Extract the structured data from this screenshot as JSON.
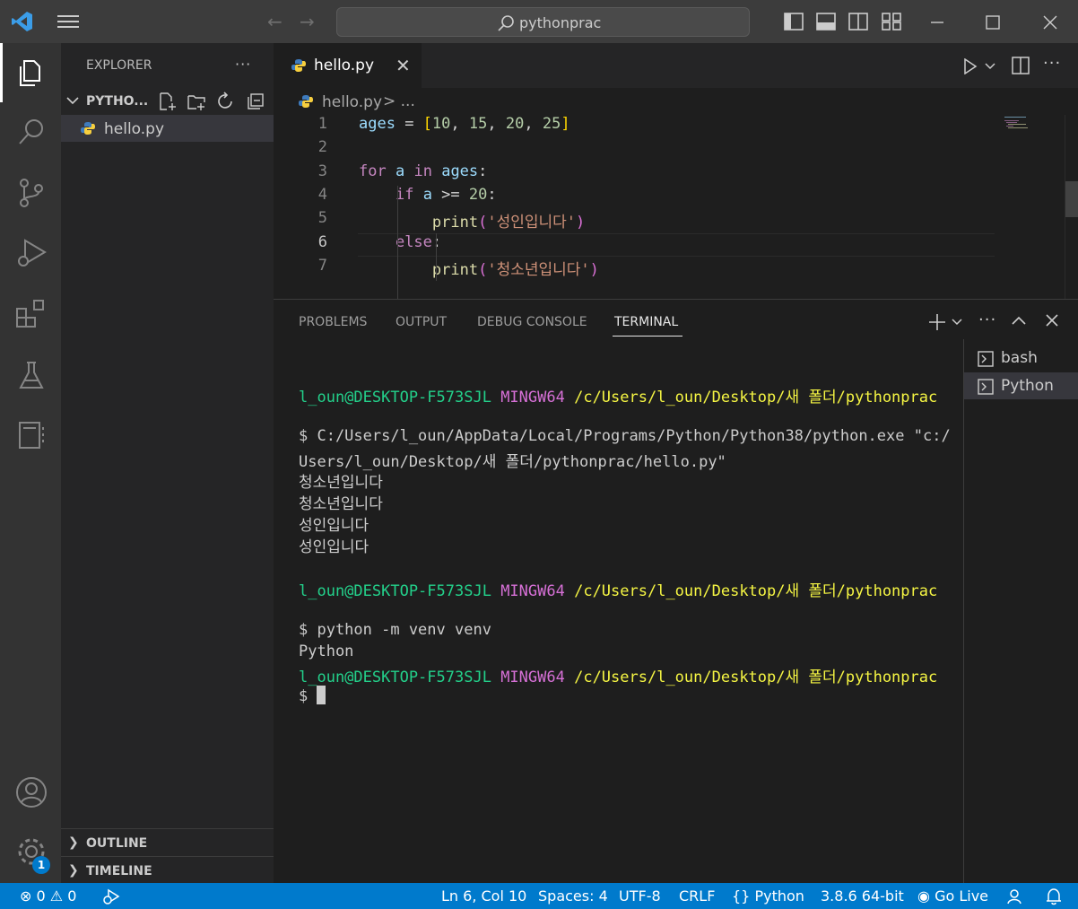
{
  "window": {
    "search_text": "pythonprac"
  },
  "sidebar": {
    "title": "EXPLORER",
    "more": "···",
    "folder": "PYTHO...",
    "file": "hello.py",
    "sections": [
      {
        "label": "OUTLINE"
      },
      {
        "label": "TIMELINE"
      }
    ]
  },
  "editor": {
    "tab_label": "hello.py",
    "breadcrumb_file": "hello.py",
    "breadcrumb_rest": "> ...",
    "line_numbers": [
      "1",
      "2",
      "3",
      "4",
      "5",
      "6",
      "7"
    ],
    "lines": [
      {
        "indent": "",
        "tokens": [
          [
            "var",
            "ages"
          ],
          [
            "op",
            " = "
          ],
          [
            "br1",
            "["
          ],
          [
            "num",
            "10"
          ],
          [
            "op",
            ", "
          ],
          [
            "num",
            "15"
          ],
          [
            "op",
            ", "
          ],
          [
            "num",
            "20"
          ],
          [
            "op",
            ", "
          ],
          [
            "num",
            "25"
          ],
          [
            "br1",
            "]"
          ]
        ]
      },
      {
        "indent": "",
        "tokens": []
      },
      {
        "indent": "",
        "tokens": [
          [
            "kw",
            "for"
          ],
          [
            "op",
            " "
          ],
          [
            "var",
            "a"
          ],
          [
            "op",
            " "
          ],
          [
            "kw",
            "in"
          ],
          [
            "op",
            " "
          ],
          [
            "var",
            "ages"
          ],
          [
            "op",
            ":"
          ]
        ]
      },
      {
        "indent": "    ",
        "tokens": [
          [
            "kw",
            "if"
          ],
          [
            "op",
            " "
          ],
          [
            "var",
            "a"
          ],
          [
            "op",
            " >= "
          ],
          [
            "num",
            "20"
          ],
          [
            "op",
            ":"
          ]
        ]
      },
      {
        "indent": "        ",
        "tokens": [
          [
            "fn",
            "print"
          ],
          [
            "br2",
            "("
          ],
          [
            "str",
            "'성인입니다'"
          ],
          [
            "br2",
            ")"
          ]
        ]
      },
      {
        "indent": "    ",
        "tokens": [
          [
            "kw",
            "else"
          ],
          [
            "op",
            ":"
          ]
        ]
      },
      {
        "indent": "        ",
        "tokens": [
          [
            "fn",
            "print"
          ],
          [
            "br2",
            "("
          ],
          [
            "str",
            "'청소년입니다'"
          ],
          [
            "br2",
            ")"
          ]
        ]
      }
    ],
    "active_line": 6
  },
  "panel": {
    "tabs": [
      "PROBLEMS",
      "OUTPUT",
      "DEBUG CONSOLE",
      "TERMINAL"
    ],
    "active_tab": "TERMINAL",
    "terminal_lines": [
      [],
      [
        [
          "t-green",
          "l_oun@DESKTOP-F573SJL"
        ],
        [
          "",
          " "
        ],
        [
          "t-magenta",
          "MINGW64"
        ],
        [
          "",
          " "
        ],
        [
          "t-yellow",
          "/c/Users/l_oun/Desktop/새 폴더/pythonprac"
        ]
      ],
      [],
      [
        [
          "",
          "$ C:/Users/l_oun/AppData/Local/Programs/Python/Python38/python.exe \"c:/"
        ]
      ],
      [
        [
          "",
          "Users/l_oun/Desktop/새 폴더/pythonprac/hello.py\""
        ]
      ],
      [
        [
          "",
          "청소년입니다"
        ]
      ],
      [
        [
          "",
          "청소년입니다"
        ]
      ],
      [
        [
          "",
          "성인입니다"
        ]
      ],
      [
        [
          "",
          "성인입니다"
        ]
      ],
      [],
      [
        [
          "t-green",
          "l_oun@DESKTOP-F573SJL"
        ],
        [
          "",
          " "
        ],
        [
          "t-magenta",
          "MINGW64"
        ],
        [
          "",
          " "
        ],
        [
          "t-yellow",
          "/c/Users/l_oun/Desktop/새 폴더/pythonprac"
        ]
      ],
      [],
      [
        [
          "",
          "$ python -m venv venv"
        ]
      ],
      [
        [
          "",
          "Python"
        ]
      ],
      [
        [
          "t-green",
          "l_oun@DESKTOP-F573SJL"
        ],
        [
          "",
          " "
        ],
        [
          "t-magenta",
          "MINGW64"
        ],
        [
          "",
          " "
        ],
        [
          "t-yellow",
          "/c/Users/l_oun/Desktop/새 폴더/pythonprac"
        ]
      ],
      [
        [
          "",
          "$ "
        ],
        [
          "cursor",
          ""
        ]
      ]
    ],
    "terminals": [
      {
        "label": "bash",
        "active": false
      },
      {
        "label": "Python",
        "active": true
      }
    ]
  },
  "statusbar": {
    "errors": "0",
    "warnings": "0",
    "position": "Ln 6, Col 10",
    "spaces": "Spaces: 4",
    "encoding": "UTF-8",
    "eol": "CRLF",
    "language": "Python",
    "interpreter": "3.8.6 64-bit",
    "golive": "Go Live",
    "settings_badge": "1"
  },
  "colors": {
    "accent": "#007acc",
    "titlebar": "#3c3c3c",
    "activitybar": "#333333",
    "sidebar": "#252526",
    "editor": "#1e1e1e"
  }
}
